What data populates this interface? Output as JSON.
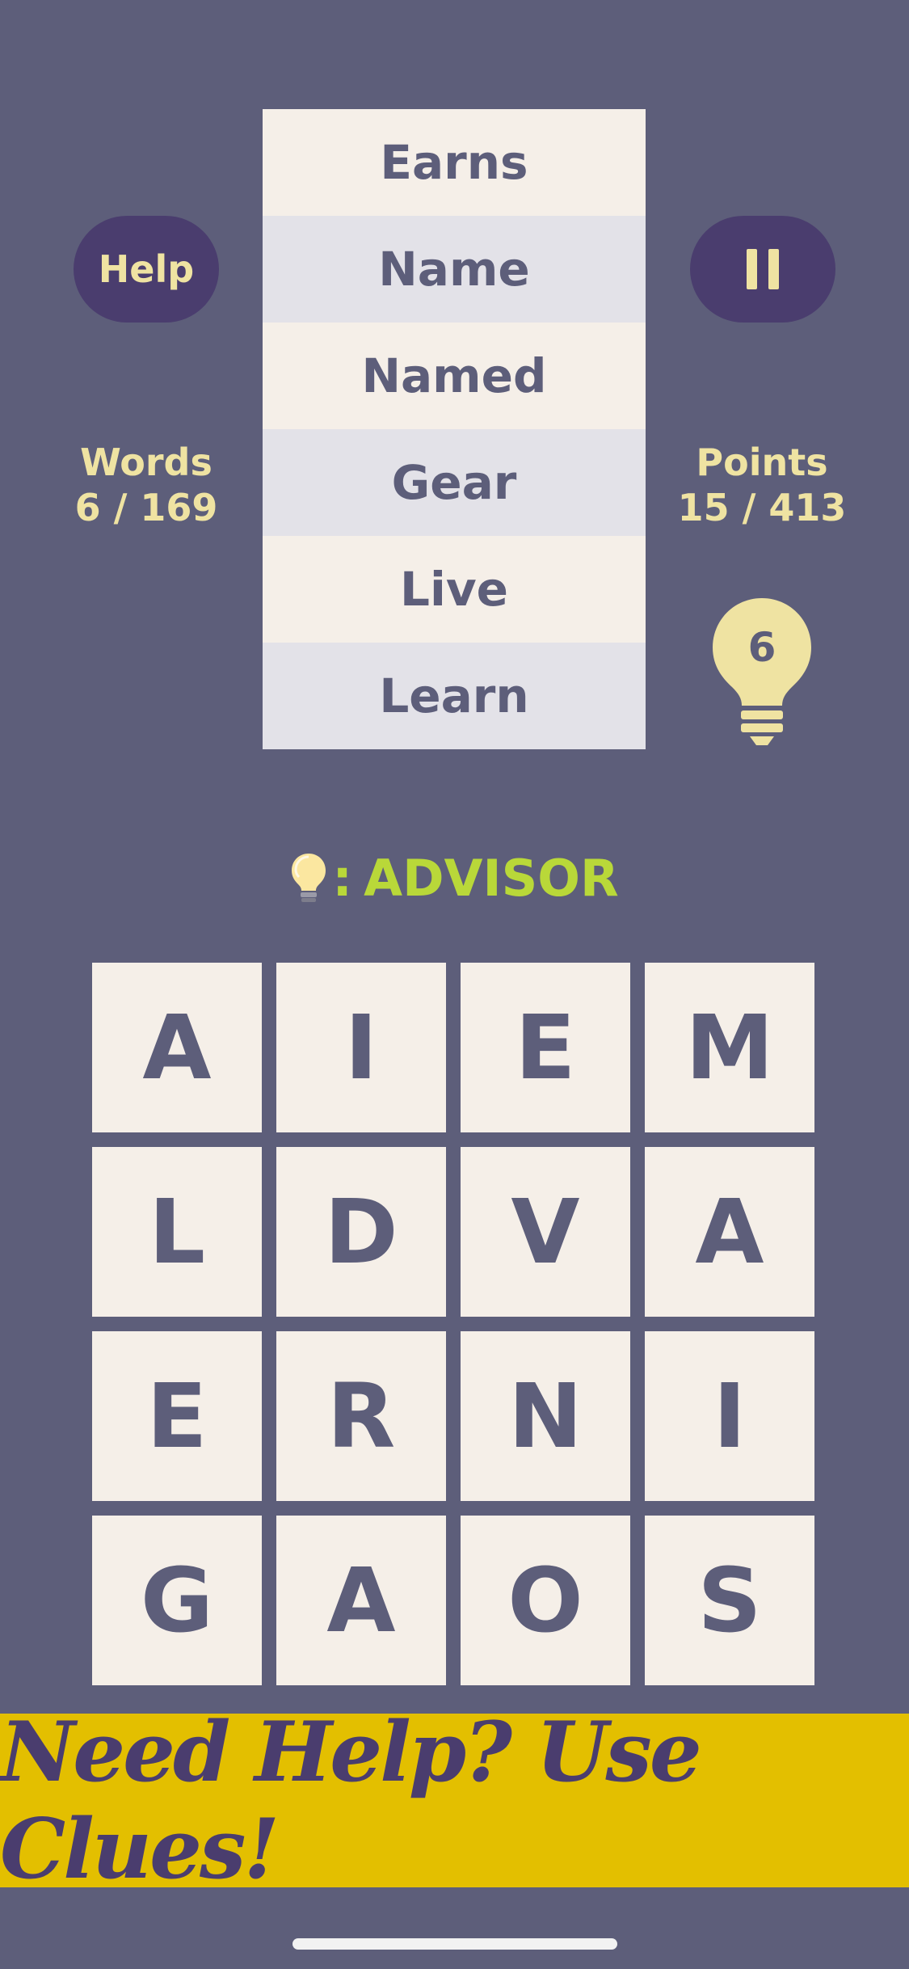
{
  "found_words": [
    "Earns",
    "Name",
    "Named",
    "Gear",
    "Live",
    "Learn"
  ],
  "buttons": {
    "help_label": "Help",
    "pause_icon": "pause-icon"
  },
  "stats": {
    "words_label": "Words",
    "words_value": "6 / 169",
    "points_label": "Points",
    "points_value": "15 / 413"
  },
  "hints": {
    "count": "6",
    "icon": "lightbulb-icon"
  },
  "hint_word": {
    "separator": ":",
    "word": "ADVISOR"
  },
  "board": {
    "rows": [
      [
        "A",
        "I",
        "E",
        "M"
      ],
      [
        "L",
        "D",
        "V",
        "A"
      ],
      [
        "E",
        "R",
        "N",
        "I"
      ],
      [
        "G",
        "A",
        "O",
        "S"
      ]
    ]
  },
  "banner": {
    "text": "Need Help? Use Clues!"
  },
  "colors": {
    "background": "#5d5e7a",
    "pill": "#4a3d6e",
    "accent_text": "#efe3a2",
    "tile": "#f5efe8",
    "row_alt": "#e3e2e8",
    "hint_green": "#b9d839",
    "banner": "#e3bf00"
  }
}
